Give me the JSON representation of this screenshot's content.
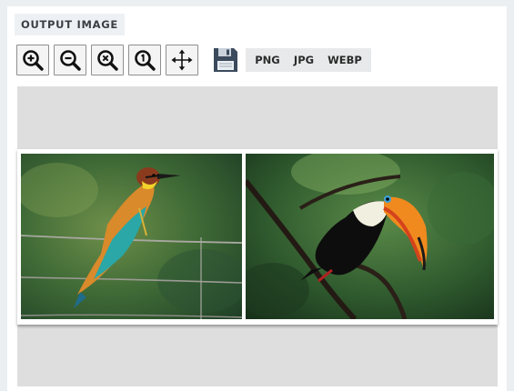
{
  "header": {
    "section_title": "OUTPUT IMAGE"
  },
  "toolbar": {
    "tools": [
      {
        "name": "zoom-in",
        "icon": "zoom-in-icon"
      },
      {
        "name": "zoom-out",
        "icon": "zoom-out-icon"
      },
      {
        "name": "zoom-reset",
        "icon": "zoom-reset-icon"
      },
      {
        "name": "zoom-actual-size",
        "icon": "zoom-one-to-one-icon"
      },
      {
        "name": "move",
        "icon": "move-arrows-icon"
      }
    ],
    "save_icon": "floppy-disk-icon",
    "formats": [
      "PNG",
      "JPG",
      "WEBP"
    ]
  },
  "canvas": {
    "photos": [
      {
        "subject": "bee-eater bird on wire",
        "icon": "bird-photo"
      },
      {
        "subject": "toucan on branch",
        "icon": "toucan-photo"
      }
    ]
  },
  "colors": {
    "panel_bg": "#ffffff",
    "page_bg": "#eceff1",
    "canvas_bg": "#dedede",
    "label_bg": "#eef1f4",
    "floppy": "#3b4a5c"
  }
}
